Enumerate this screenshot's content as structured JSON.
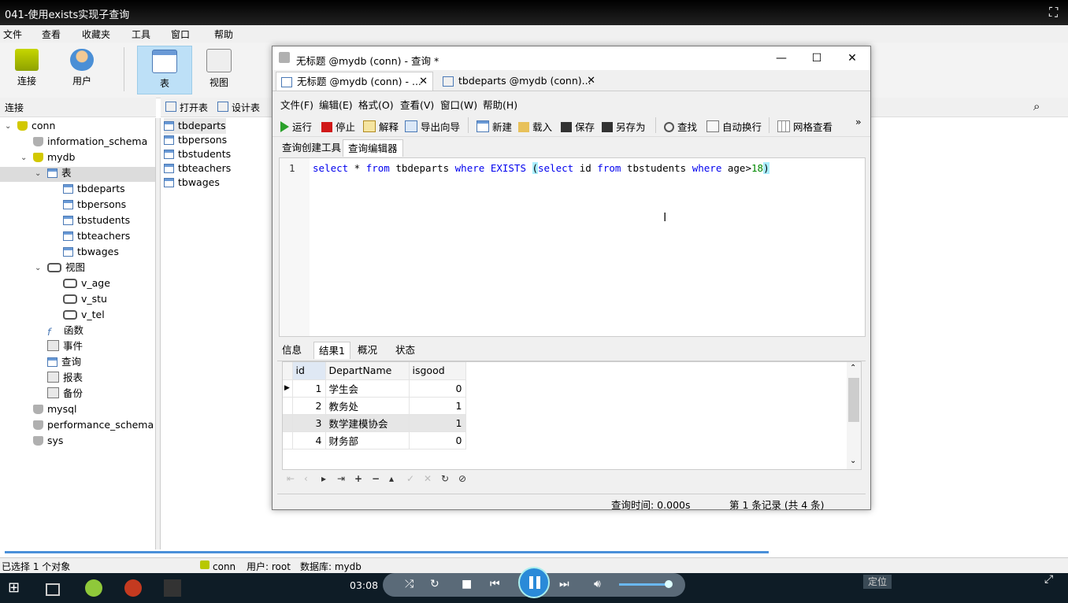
{
  "video": {
    "title": "041-使用exists实现子查询",
    "time": "03:08",
    "locate_label": "定位"
  },
  "menu": [
    "文件",
    "查看",
    "收藏夹",
    "工具",
    "窗口",
    "帮助"
  ],
  "toolbar": [
    {
      "label": "连接",
      "icon": "connect-icon"
    },
    {
      "label": "用户",
      "icon": "user-icon"
    },
    {
      "label": "表",
      "icon": "table-icon",
      "selected": true
    },
    {
      "label": "视图",
      "icon": "view-icon"
    }
  ],
  "conn_header": "连接",
  "obj_toolbar": {
    "open": "打开表",
    "design": "设计表"
  },
  "tree": {
    "conn": "conn",
    "information_schema": "information_schema",
    "mydb": "mydb",
    "tables_label": "表",
    "tables": [
      "tbdeparts",
      "tbpersons",
      "tbstudents",
      "tbteachers",
      "tbwages"
    ],
    "views_label": "视图",
    "views": [
      "v_age",
      "v_stu",
      "v_tel"
    ],
    "functions": "函数",
    "events": "事件",
    "queries": "查询",
    "reports": "报表",
    "backup": "备份",
    "mysql": "mysql",
    "performance_schema": "performance_schema",
    "sys": "sys"
  },
  "objects": [
    "tbdeparts",
    "tbpersons",
    "tbstudents",
    "tbteachers",
    "tbwages"
  ],
  "status": {
    "selected": "已选择 1 个对象",
    "conn": "conn",
    "user": "用户: root",
    "db": "数据库: mydb"
  },
  "query_window": {
    "title": "无标题 @mydb (conn) - 查询 *",
    "tabs": [
      "无标题 @mydb (conn) - ...",
      "tbdeparts @mydb (conn)..."
    ],
    "menu": [
      "文件(F)",
      "编辑(E)",
      "格式(O)",
      "查看(V)",
      "窗口(W)",
      "帮助(H)"
    ],
    "tools": [
      "运行",
      "停止",
      "解释",
      "导出向导",
      "新建",
      "载入",
      "保存",
      "另存为",
      "查找",
      "自动换行",
      "网格查看"
    ],
    "subtabs": [
      "查询创建工具",
      "查询编辑器"
    ],
    "line_number": "1",
    "sql": {
      "t1": "select",
      "t2": " * ",
      "t3": "from",
      "t4": " tbdeparts ",
      "t5": "where",
      "t6": " ",
      "t7": "EXISTS",
      "t8": " ",
      "t9": "(",
      "t10": "select",
      "t11": " id ",
      "t12": "from",
      "t13": " tbstudents ",
      "t14": "where",
      "t15": " age>",
      "t16": "18",
      "t17": ")"
    },
    "result_tabs": [
      "信息",
      "结果1",
      "概况",
      "状态"
    ],
    "columns": [
      "id",
      "DepartName",
      "isgood"
    ],
    "rows": [
      {
        "id": "1",
        "DepartName": "学生会",
        "isgood": "0"
      },
      {
        "id": "2",
        "DepartName": "教务处",
        "isgood": "1"
      },
      {
        "id": "3",
        "DepartName": "数学建模协会",
        "isgood": "1"
      },
      {
        "id": "4",
        "DepartName": "财务部",
        "isgood": "0"
      }
    ],
    "query_time": "查询时间: 0.000s",
    "record_info": "第 1 条记录 (共 4 条)"
  }
}
